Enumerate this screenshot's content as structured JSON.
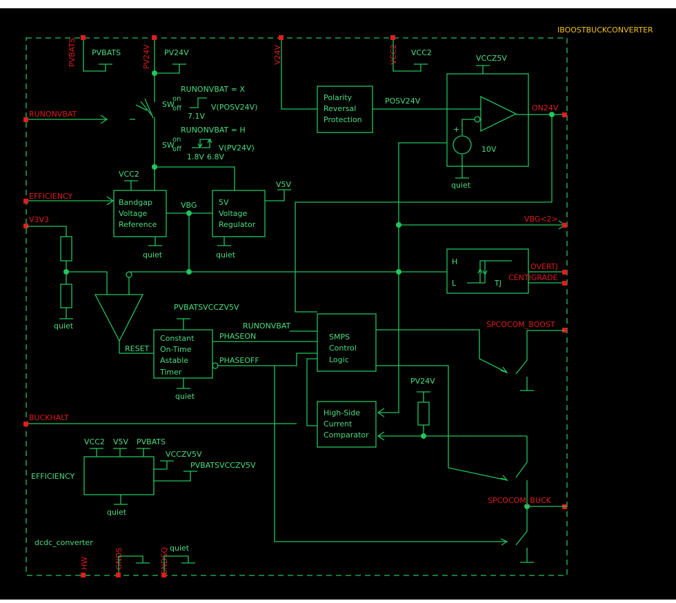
{
  "colors": {
    "background": "#000000",
    "wire": "#22c55e",
    "pin": "#e11d1d",
    "title": "#f5c518"
  },
  "title": "IBOOSTBUCKCONVERTER",
  "instance_name": "dcdc_converter",
  "ports": {
    "pvbats": "PVBATS",
    "pv24v": "PV24V",
    "v24v": "V24V",
    "vcc2": "VCC2",
    "runonvbat": "RUNONVBAT",
    "efficiency": "EFFICIENCY",
    "v3v3": "V3V3",
    "buckhalt": "BUCKHALT",
    "on24v": "ON24V",
    "vbg2": "VBG<2>",
    "overtj": "OVERTJ",
    "centigrade": "CENTIGRADE",
    "spcocom_boost": "SPCOCOM_BOOST",
    "spcocom_buck": "SPCOCOM_BUCK",
    "hw": "HW",
    "gnds": "GNDS",
    "gndsq": "GNDSQ"
  },
  "nets": {
    "pvbats": "PVBATS",
    "pv24v": "PV24V",
    "vcc2": "VCC2",
    "vccz5v": "VCCZ5V",
    "vcc2_bg": "VCC2",
    "v5v": "V5V",
    "vbg": "VBG",
    "quiet": "quiet",
    "posv24v": "POSV24V",
    "pvbatsvccz5v": "PVBATSVCCZV5V",
    "runonvbat": "RUNONVBAT",
    "phaseon": "PHASEON",
    "phaseoff": "PHASEOFF",
    "reset": "RESET",
    "pv24v_hs": "PV24V",
    "eff_vcc2": "VCC2",
    "eff_v5v": "V5V",
    "eff_pvbats": "PVBATS",
    "eff_vccz5v": "VCCZV5V",
    "eff_pvbatsvccz5v": "PVBATSVCCZV5V"
  },
  "switch_notes": {
    "line1": "RUNONVBAT = X",
    "sw": "SW",
    "on": "on",
    "off": "off",
    "v1": "7.1V",
    "vpos": "V(POSV24V)",
    "line2": "RUNONVBAT = H",
    "v2a": "1.8V",
    "v2b": "6.8V",
    "vpv": "V(PV24V)"
  },
  "blocks": {
    "polarity": [
      "Polarity",
      "Reversal",
      "Protection"
    ],
    "bandgap": [
      "Bandgap",
      "Voltage",
      "Reference"
    ],
    "regulator": [
      "5V",
      "Voltage",
      "Regulator"
    ],
    "timer": [
      "Constant",
      "On-Time",
      "Astable",
      "Timer"
    ],
    "smps": [
      "SMPS",
      "Control",
      "Logic"
    ],
    "hsc": [
      "High-Side",
      "Current",
      "Comparator"
    ],
    "efficiency": "EFFICIENCY",
    "tj_h": "H",
    "tj_l": "L",
    "tj": "TJ",
    "comp_plus": "+",
    "comp_volt": "10V"
  }
}
